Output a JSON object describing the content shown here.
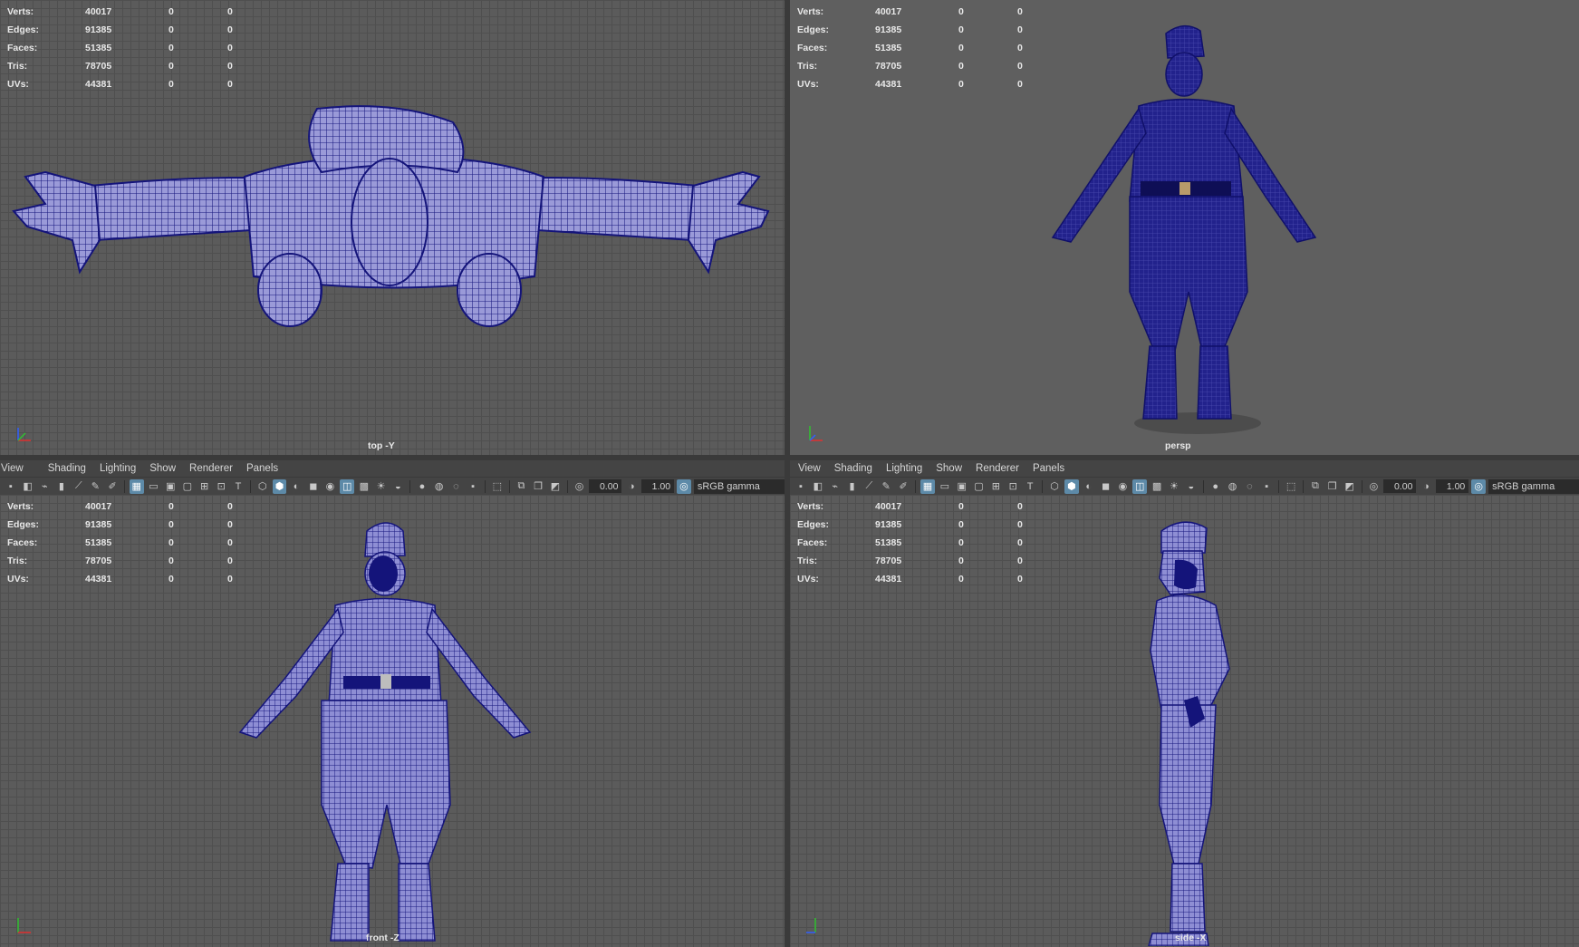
{
  "stats": {
    "rows": [
      {
        "label": "Verts:",
        "value": "40017",
        "a": "0",
        "b": "0"
      },
      {
        "label": "Edges:",
        "value": "91385",
        "a": "0",
        "b": "0"
      },
      {
        "label": "Faces:",
        "value": "51385",
        "a": "0",
        "b": "0"
      },
      {
        "label": "Tris:",
        "value": "78705",
        "a": "0",
        "b": "0"
      },
      {
        "label": "UVs:",
        "value": "44381",
        "a": "0",
        "b": "0"
      }
    ]
  },
  "panels": {
    "top": {
      "camera": "top -Y"
    },
    "persp": {
      "camera": "persp"
    },
    "front": {
      "camera": "front -Z"
    },
    "side": {
      "camera": "side -X"
    }
  },
  "menu": {
    "view": "View",
    "shading": "Shading",
    "lighting": "Lighting",
    "show": "Show",
    "renderer": "Renderer",
    "panels": "Panels"
  },
  "toolbar": {
    "exposure": "0.00",
    "gamma": "1.00",
    "color_space": "sRGB gamma"
  },
  "colors": {
    "mesh": "#14147a",
    "wire": "#9a9ad8",
    "viewport_bg": "#5e5e5e",
    "grid": "#4f4f4f",
    "axis_x": "#e03030",
    "axis_y": "#30c030",
    "axis_z": "#3060ff"
  }
}
